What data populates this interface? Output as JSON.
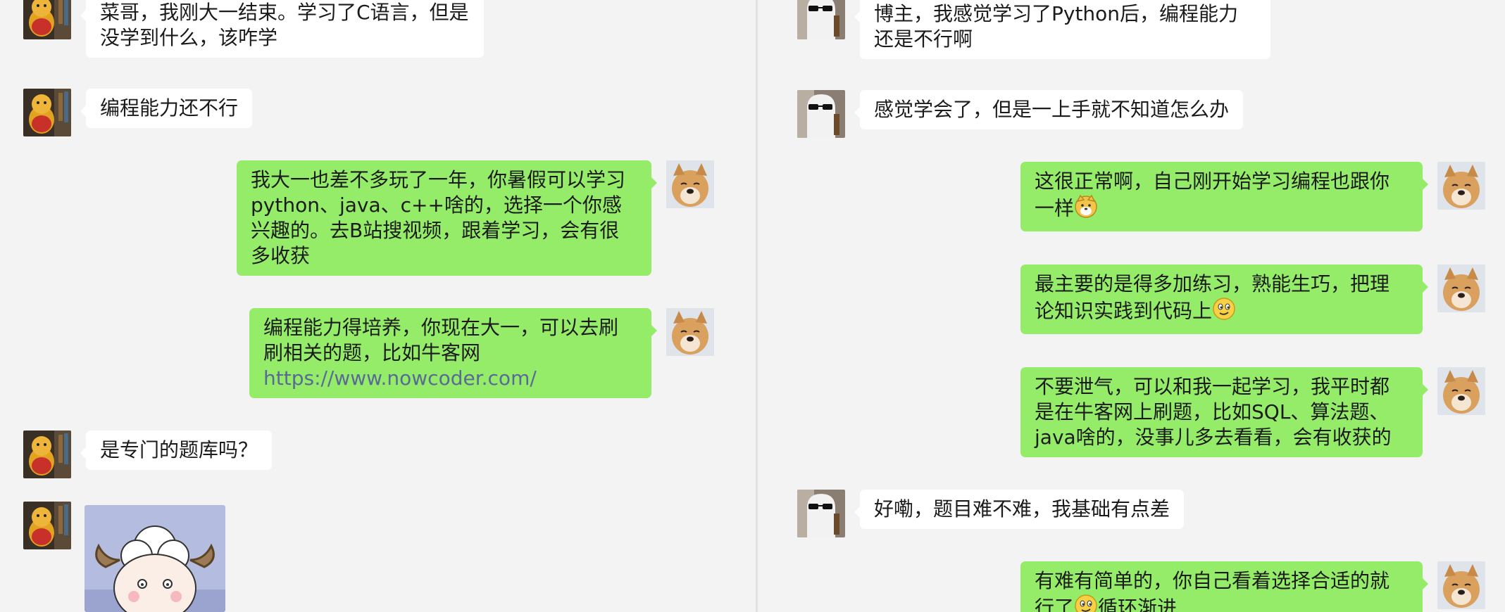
{
  "left_chat": {
    "messages": [
      {
        "from": "other",
        "text": "菜哥，我刚大一结束。学习了C语言，但是没学到什么，该咋学"
      },
      {
        "from": "other",
        "text": "编程能力还不行"
      },
      {
        "from": "me",
        "text": "我大一也差不多玩了一年，你暑假可以学习python、java、c++啥的，选择一个你感兴趣的。去B站搜视频，跟着学习，会有很多收获"
      },
      {
        "from": "me",
        "text_prefix": "编程能力得培养，你现在大一，可以去刷刷相关的题，比如牛客网",
        "link": "https://www.nowcoder.com/"
      },
      {
        "from": "other",
        "text": "是专门的题库吗？"
      },
      {
        "from": "other",
        "type": "image",
        "image_desc": "cartoon-sheep-sticker"
      }
    ]
  },
  "right_chat": {
    "messages": [
      {
        "from": "other",
        "text": "博主，我感觉学习了Python后，编程能力还是不行啊"
      },
      {
        "from": "other",
        "text": "感觉学会了，但是一上手就不知道怎么办"
      },
      {
        "from": "me",
        "text": "这很正常啊，自己刚开始学习编程也跟你一样",
        "emoji": "dog-face-emoji"
      },
      {
        "from": "me",
        "text": "最主要的是得多加练习，熟能生巧，把理论知识实践到代码上",
        "emoji": "smirk-emoji"
      },
      {
        "from": "me",
        "text": "不要泄气，可以和我一起学习，我平时都是在牛客网上刷题，比如SQL、算法题、java啥的，没事儿多去看看，会有收获的"
      },
      {
        "from": "other",
        "text": "好嘞，题目难不难，我基础有点差"
      },
      {
        "from": "me",
        "text_prefix": "有难有简单的，你自己看着选择合适的就行了",
        "emoji": "smirk-emoji",
        "text_suffix": "循环渐进"
      }
    ]
  },
  "colors": {
    "outgoing": "#95ec69",
    "incoming": "#ffffff",
    "background": "#f3f3f3",
    "link": "#576b95"
  }
}
